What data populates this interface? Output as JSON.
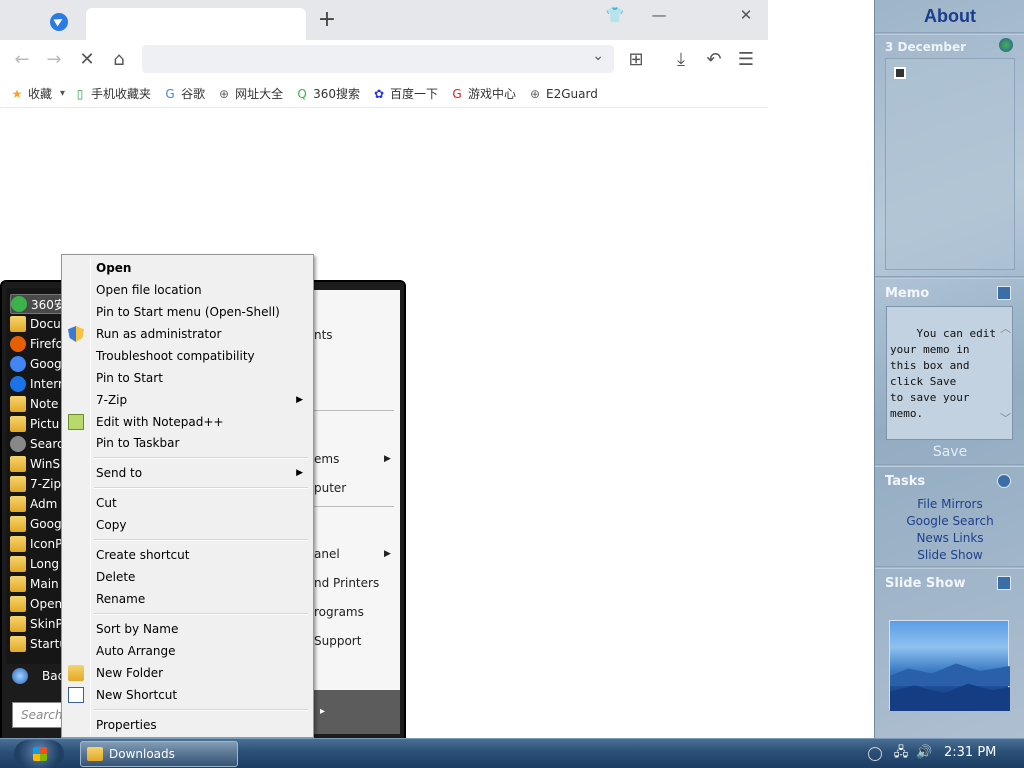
{
  "browser": {
    "toolbar": {
      "back": "←",
      "forward": "→",
      "stop": "✕",
      "home": "⌂",
      "address_value": "",
      "dropdown": "⌄",
      "apps": "⊞",
      "download": "⤓",
      "undo": "↶",
      "menu": "☰"
    },
    "window_controls": {
      "tshirt": "👕",
      "minimize": "—",
      "close": "✕"
    },
    "new_tab": "+",
    "bookmarks": [
      {
        "label": "收藏",
        "icon": "star-icon",
        "glyph": "★",
        "color": "#f5a623"
      },
      {
        "label": "手机收藏夹",
        "icon": "phone-icon",
        "glyph": "▯",
        "color": "#2aa54a"
      },
      {
        "label": "谷歌",
        "icon": "google-icon",
        "glyph": "G",
        "color": "#4285f4"
      },
      {
        "label": "网址大全",
        "icon": "globe-icon",
        "glyph": "⊕",
        "color": "#666666"
      },
      {
        "label": "360搜索",
        "icon": "360-search-icon",
        "glyph": "Q",
        "color": "#3bb34a"
      },
      {
        "label": "百度一下",
        "icon": "baidu-paw-icon",
        "glyph": "✿",
        "color": "#2932e1"
      },
      {
        "label": "游戏中心",
        "icon": "game-center-icon",
        "glyph": "G",
        "color": "#e02020"
      },
      {
        "label": "E2Guard",
        "icon": "globe-icon",
        "glyph": "⊕",
        "color": "#666666"
      }
    ]
  },
  "sidebar": {
    "about": "About",
    "calendar_date": "3 December",
    "memo_title": "Memo",
    "memo_text": "You can edit\nyour memo in\nthis box and\nclick Save\nto save your\nmemo.",
    "save_label": "Save",
    "tasks_title": "Tasks",
    "tasks": [
      "File Mirrors",
      "Google Search",
      "News Links",
      "Slide Show"
    ],
    "slideshow_title": "Slide Show"
  },
  "start_menu": {
    "pinned": [
      "360安",
      "Docu",
      "Firefo",
      "Goog",
      "Interr",
      "Note",
      "Pictu",
      "Searc",
      "WinS",
      "7-Zip",
      "Adm",
      "Goog",
      "IconP",
      "Long",
      "Main",
      "Open",
      "SkinP",
      "Startu"
    ],
    "right_items": [
      "nts",
      "ems",
      "puter",
      "anel",
      "nd Printers",
      "rograms",
      "Support"
    ],
    "back": "Bac",
    "search_placeholder": "Search p",
    "power_arrow": "▸"
  },
  "context_menu": {
    "items": {
      "open": "Open",
      "open_location": "Open file location",
      "pin_start_openshell": "Pin to Start menu (Open-Shell)",
      "run_admin": "Run as administrator",
      "troubleshoot": "Troubleshoot compatibility",
      "pin_start": "Pin to Start",
      "sevenzip": "7-Zip",
      "notepadpp": "Edit with Notepad++",
      "pin_taskbar": "Pin to Taskbar",
      "send_to": "Send to",
      "cut": "Cut",
      "copy": "Copy",
      "create_shortcut": "Create shortcut",
      "delete": "Delete",
      "rename": "Rename",
      "sort_name": "Sort by Name",
      "auto_arrange": "Auto Arrange",
      "new_folder": "New Folder",
      "new_shortcut": "New Shortcut",
      "properties": "Properties"
    },
    "submenu_arrow": "▶"
  },
  "taskbar": {
    "task_label": "Downloads",
    "clock": "2:31 PM"
  }
}
